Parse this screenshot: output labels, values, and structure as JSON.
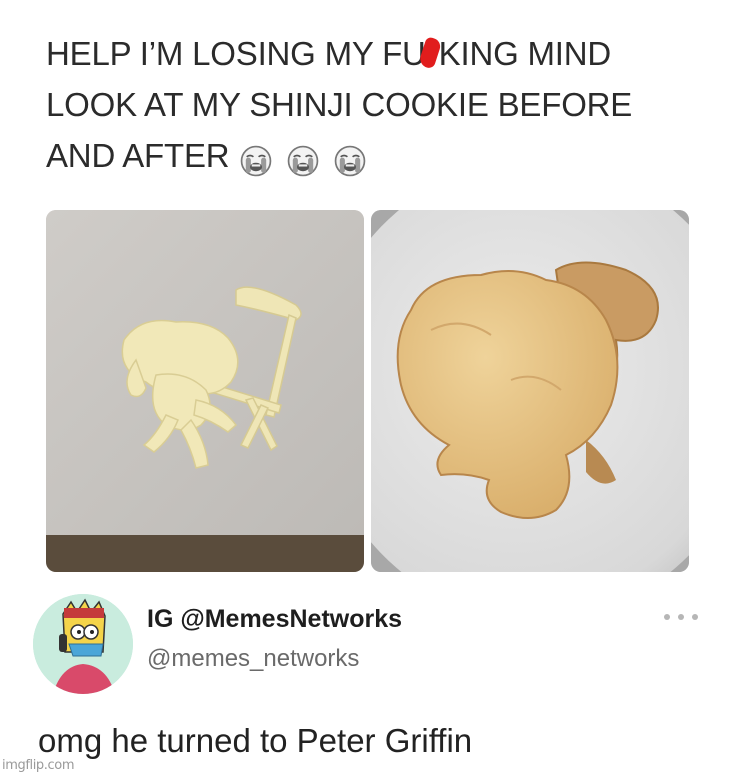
{
  "post": {
    "line1_part1": "HELP I’M LOSING MY FU",
    "line1_part2": "KING MIND",
    "line2": "LOOK AT MY SHINJI COOKIE BEFORE",
    "line3": "AND AFTER",
    "emojis": [
      "loudly-crying-face-icon",
      "loudly-crying-face-icon",
      "loudly-crying-face-icon"
    ],
    "censor_color": "#e11d1d"
  },
  "images": {
    "before": "cookie dough shaped like a figure on a chair, on baking paper",
    "after": "baked cookie that spread into a round figure, on a plate"
  },
  "author": {
    "display_name": "IG @MemesNetworks",
    "handle": "@memes_networks",
    "avatar_icon": "cartoon-avatar-icon",
    "more_icon": "more-dots-icon"
  },
  "reply": {
    "text": "omg he turned to Peter Griffin"
  },
  "watermark": {
    "text": "imgflip.com"
  }
}
